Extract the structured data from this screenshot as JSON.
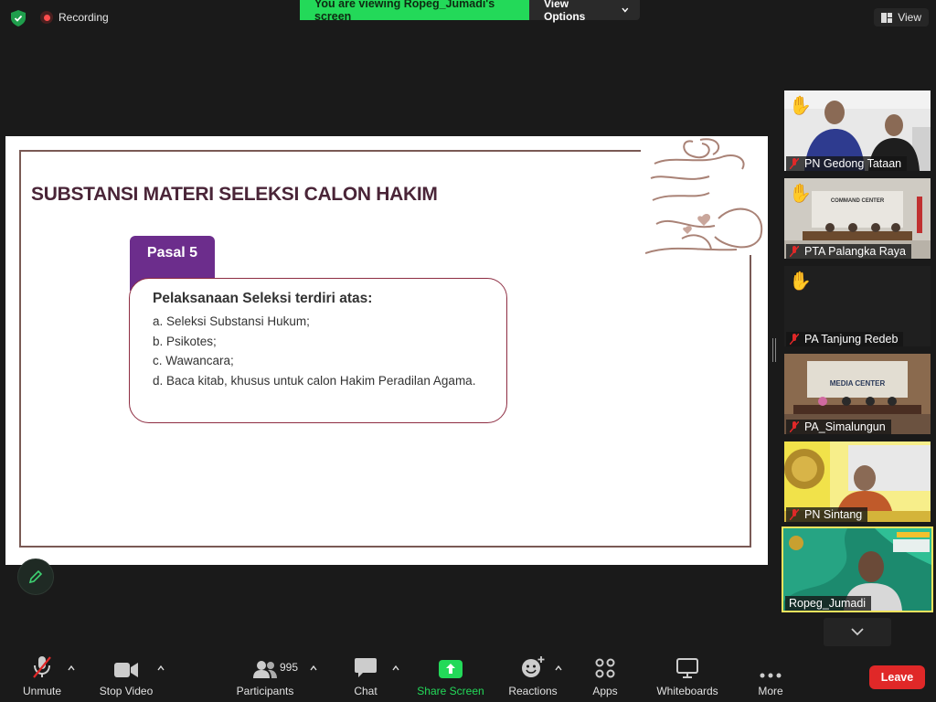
{
  "topbar": {
    "recording_label": "Recording",
    "banner_text": "You are viewing Ropeg_Jumadi's screen",
    "view_options_label": "View Options",
    "view_label": "View"
  },
  "slide": {
    "title": "SUBSTANSI MATERI SELEKSI CALON HAKIM",
    "tab_label": "Pasal 5",
    "box_heading": "Pelaksanaan Seleksi terdiri atas:",
    "items": [
      "a. Seleksi Substansi Hukum;",
      "b. Psikotes;",
      "c. Wawancara;",
      "d. Baca kitab, khusus untuk calon Hakim Peradilan Agama."
    ]
  },
  "participants": [
    {
      "name": "PN Gedong Tataan",
      "hand": true,
      "muted": true
    },
    {
      "name": "PTA Palangka Raya",
      "hand": true,
      "muted": true
    },
    {
      "name": "PA Tanjung Redeb",
      "hand": true,
      "muted": true
    },
    {
      "name": "PA_Simalungun",
      "hand": false,
      "muted": true
    },
    {
      "name": "PN Sintang",
      "hand": false,
      "muted": true
    },
    {
      "name": "Ropeg_Jumadi",
      "hand": false,
      "muted": false
    }
  ],
  "toolbar": {
    "unmute": "Unmute",
    "stop_video": "Stop Video",
    "participants": "Participants",
    "participants_count": "995",
    "chat": "Chat",
    "share_screen": "Share Screen",
    "reactions": "Reactions",
    "apps": "Apps",
    "whiteboards": "Whiteboards",
    "more": "More",
    "leave": "Leave"
  },
  "colors": {
    "share_green": "#23d959",
    "leave_red": "#e02828",
    "slide_title": "#4a2538",
    "tab_purple": "#6c2d8c",
    "active_speaker_border": "#f2e35e"
  }
}
